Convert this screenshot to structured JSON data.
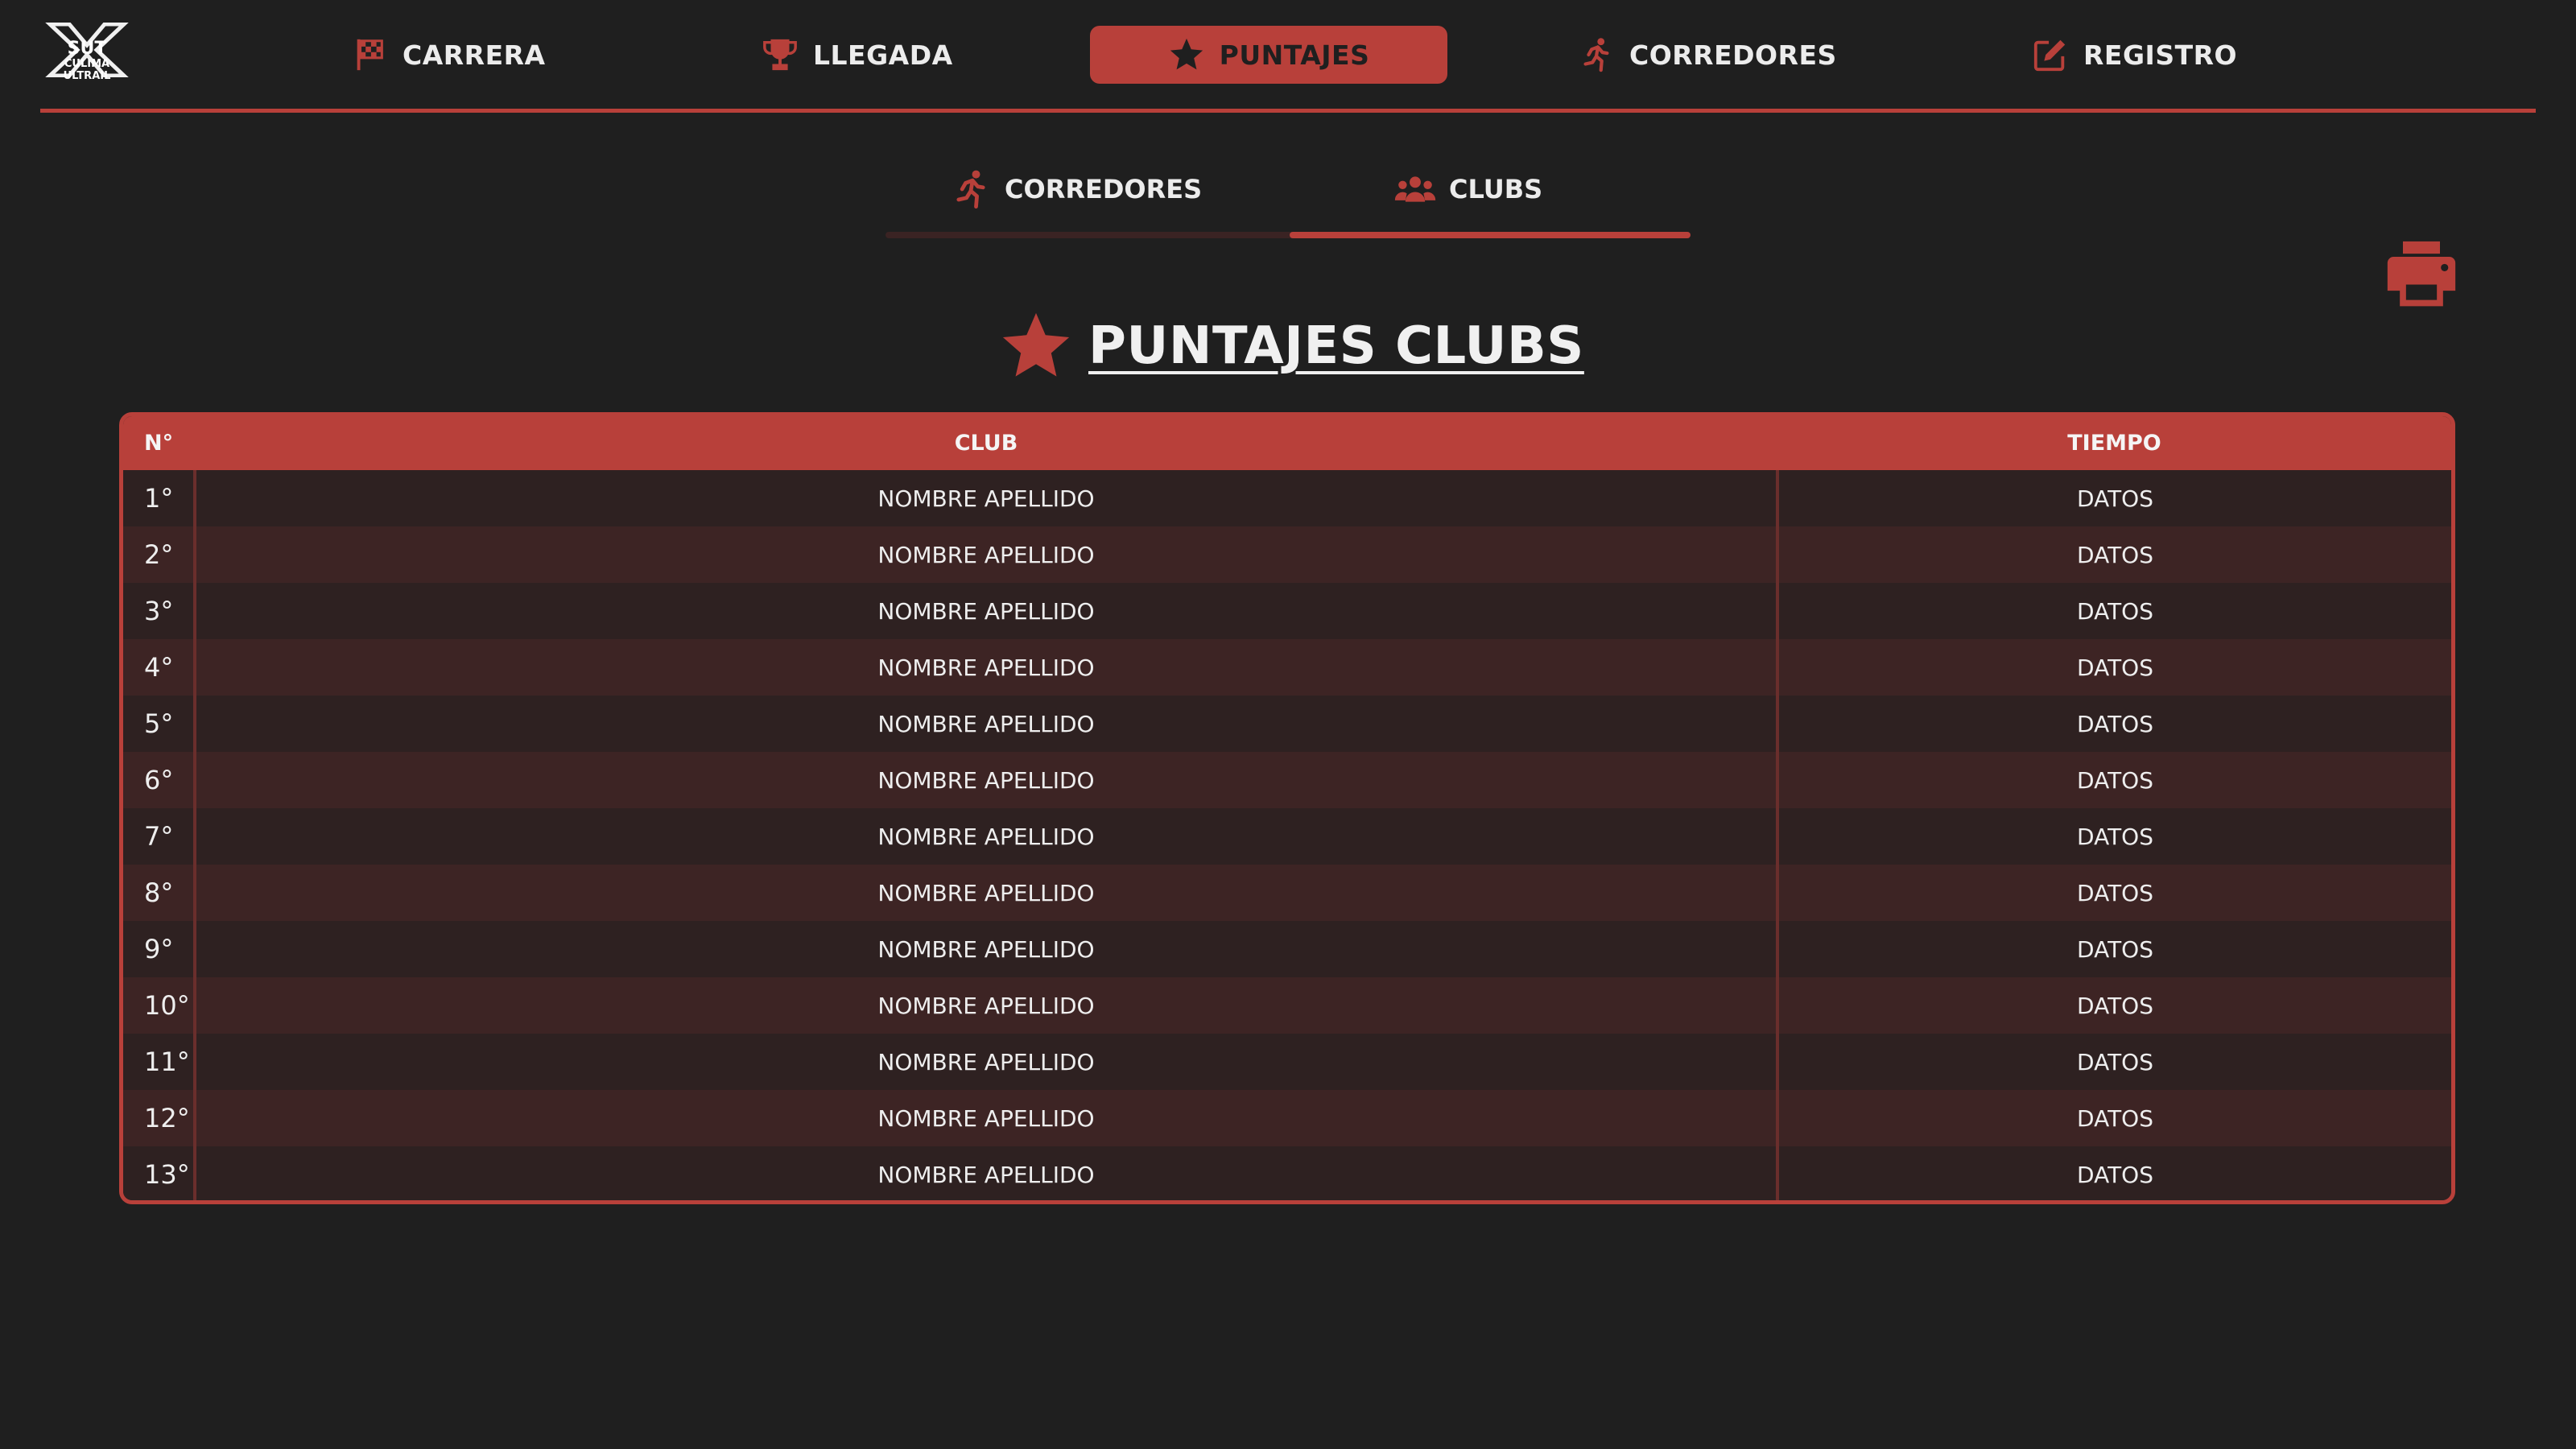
{
  "brand": {
    "logo_text_top": "SUT",
    "logo_text_bottom": "CULIMA ULTRAIL"
  },
  "nav": {
    "items": [
      {
        "label": "CARRERA",
        "icon": "flag-icon"
      },
      {
        "label": "LLEGADA",
        "icon": "trophy-icon"
      },
      {
        "label": "PUNTAJES",
        "icon": "star-icon",
        "active": true
      },
      {
        "label": "CORREDORES",
        "icon": "runner-icon"
      },
      {
        "label": "REGISTRO",
        "icon": "edit-icon"
      }
    ]
  },
  "subtabs": {
    "items": [
      {
        "label": "CORREDORES",
        "icon": "runner-icon"
      },
      {
        "label": "CLUBS",
        "icon": "users-icon",
        "active": true
      }
    ]
  },
  "page": {
    "title": "PUNTAJES CLUBS"
  },
  "table": {
    "headers": {
      "n": "N°",
      "club": "CLUB",
      "time": "TIEMPO"
    },
    "rows": [
      {
        "n": "1°",
        "club": "NOMBRE APELLIDO",
        "time": "DATOS"
      },
      {
        "n": "2°",
        "club": "NOMBRE APELLIDO",
        "time": "DATOS"
      },
      {
        "n": "3°",
        "club": "NOMBRE APELLIDO",
        "time": "DATOS"
      },
      {
        "n": "4°",
        "club": "NOMBRE APELLIDO",
        "time": "DATOS"
      },
      {
        "n": "5°",
        "club": "NOMBRE APELLIDO",
        "time": "DATOS"
      },
      {
        "n": "6°",
        "club": "NOMBRE APELLIDO",
        "time": "DATOS"
      },
      {
        "n": "7°",
        "club": "NOMBRE APELLIDO",
        "time": "DATOS"
      },
      {
        "n": "8°",
        "club": "NOMBRE APELLIDO",
        "time": "DATOS"
      },
      {
        "n": "9°",
        "club": "NOMBRE APELLIDO",
        "time": "DATOS"
      },
      {
        "n": "10°",
        "club": "NOMBRE APELLIDO",
        "time": "DATOS"
      },
      {
        "n": "11°",
        "club": "NOMBRE APELLIDO",
        "time": "DATOS"
      },
      {
        "n": "12°",
        "club": "NOMBRE APELLIDO",
        "time": "DATOS"
      },
      {
        "n": "13°",
        "club": "NOMBRE APELLIDO",
        "time": "DATOS"
      }
    ]
  },
  "colors": {
    "accent": "#b8403a",
    "background": "#1f1f1f",
    "row_odd": "#2e2121",
    "row_even": "#3d2424"
  }
}
